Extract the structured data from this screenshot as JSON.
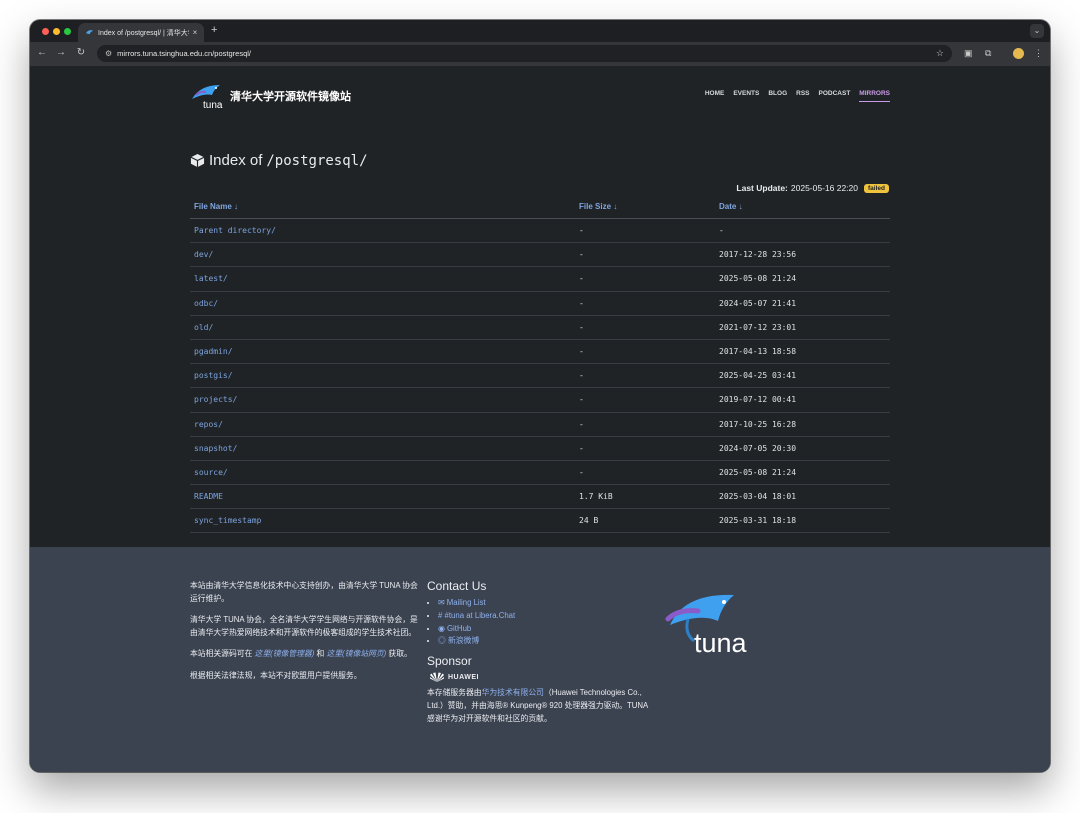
{
  "browser": {
    "tab_title": "Index of /postgresql/ | 清华大学...",
    "url": "mirrors.tuna.tsinghua.edu.cn/postgresql/",
    "new_tab": "+",
    "tab_close": "×"
  },
  "site": {
    "brand": "清华大学开源软件镜像站",
    "logo_text": "tuna",
    "nav": [
      {
        "label": "HOME",
        "active": false
      },
      {
        "label": "EVENTS",
        "active": false
      },
      {
        "label": "BLOG",
        "active": false
      },
      {
        "label": "RSS",
        "active": false
      },
      {
        "label": "PODCAST",
        "active": false
      },
      {
        "label": "MIRRORS",
        "active": true
      }
    ]
  },
  "index": {
    "title": "Index of",
    "path": "/postgresql/",
    "last_update_label": "Last Update:",
    "last_update_value": "2025-05-16 22:20",
    "status": "failed",
    "columns": {
      "name": "File Name ↓",
      "size": "File Size ↓",
      "date": "Date ↓"
    },
    "rows": [
      {
        "name": "Parent directory/",
        "size": "-",
        "date": "-"
      },
      {
        "name": "dev/",
        "size": "-",
        "date": "2017-12-28 23:56"
      },
      {
        "name": "latest/",
        "size": "-",
        "date": "2025-05-08 21:24"
      },
      {
        "name": "odbc/",
        "size": "-",
        "date": "2024-05-07 21:41"
      },
      {
        "name": "old/",
        "size": "-",
        "date": "2021-07-12 23:01"
      },
      {
        "name": "pgadmin/",
        "size": "-",
        "date": "2017-04-13 18:58"
      },
      {
        "name": "postgis/",
        "size": "-",
        "date": "2025-04-25 03:41"
      },
      {
        "name": "projects/",
        "size": "-",
        "date": "2019-07-12 00:41"
      },
      {
        "name": "repos/",
        "size": "-",
        "date": "2017-10-25 16:28"
      },
      {
        "name": "snapshot/",
        "size": "-",
        "date": "2024-07-05 20:30"
      },
      {
        "name": "source/",
        "size": "-",
        "date": "2025-05-08 21:24"
      },
      {
        "name": "README",
        "size": "1.7 KiB",
        "date": "2025-03-04 18:01"
      },
      {
        "name": "sync_timestamp",
        "size": "24 B",
        "date": "2025-03-31 18:18"
      }
    ]
  },
  "footer": {
    "p1": "本站由清华大学信息化技术中心支持创办，由清华大学 TUNA 协会运行维护。",
    "p2": "清华大学 TUNA 协会，全名清华大学学生网络与开源软件协会，是由清华大学热爱网络技术和开源软件的极客组成的学生技术社团。",
    "p3_prefix": "本站相关源码可在",
    "p3_link1": "这里(镜像管理器)",
    "p3_mid": "和",
    "p3_link2": "这里(镜像站网页)",
    "p3_suffix": "获取。",
    "p4": "根据相关法律法规，本站不对欧盟用户提供服务。",
    "contact_title": "Contact Us",
    "contacts": [
      {
        "icon": "✉",
        "label": "Mailing List"
      },
      {
        "icon": "#",
        "label": "#tuna at Libera.Chat"
      },
      {
        "icon": "◉",
        "label": "GitHub"
      },
      {
        "icon": "◎",
        "label": "新浪微博"
      }
    ],
    "sponsor_title": "Sponsor",
    "sponsor_logo_text": "HUAWEI",
    "sponsor_prefix": "本存储服务器由",
    "sponsor_link": "华为技术有限公司",
    "sponsor_suffix": "（Huawei Technologies Co., Ltd.）赞助，并由海思® Kunpeng® 920 处理器强力驱动。TUNA 感谢华为对开源软件和社区的贡献。",
    "big_logo_text": "tuna"
  },
  "colors": {
    "accent": "#7ba3de",
    "nav_active": "#c89be6",
    "badge": "#f0c33c",
    "footer_bg": "#3b4250",
    "page_bg": "#202326"
  }
}
